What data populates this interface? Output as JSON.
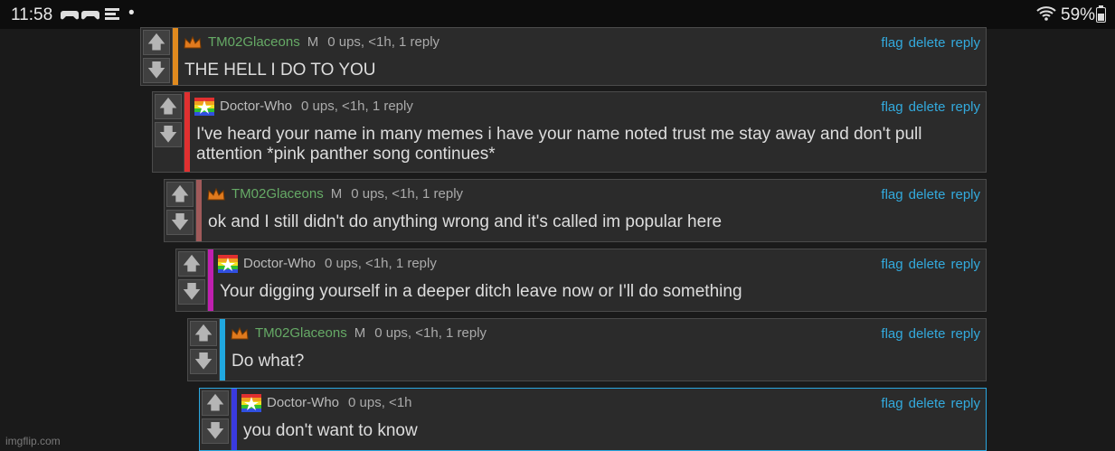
{
  "status_bar": {
    "time": "11:58",
    "battery": "59%"
  },
  "actions": {
    "flag": "flag",
    "delete": "delete",
    "reply": "reply"
  },
  "comments": [
    {
      "user": "TM02Glaceons",
      "badge": "M",
      "stats": "0 ups, <1h, 1 reply",
      "text": "THE HELL I DO TO YOU",
      "bar_color": "#e08a1e"
    },
    {
      "user": "Doctor-Who",
      "badge": "",
      "stats": "0 ups, <1h, 1 reply",
      "text": "I've heard your name in many memes i have your name noted trust me stay away and don't pull attention *pink panther song continues*",
      "bar_color": "#e03030"
    },
    {
      "user": "TM02Glaceons",
      "badge": "M",
      "stats": "0 ups, <1h, 1 reply",
      "text": "ok and I still didn't do anything wrong and it's called im popular here",
      "bar_color": "#a05a5a"
    },
    {
      "user": "Doctor-Who",
      "badge": "",
      "stats": "0 ups, <1h, 1 reply",
      "text": "Your digging yourself in a deeper ditch leave now or I'll do something",
      "bar_color": "#c020b0"
    },
    {
      "user": "TM02Glaceons",
      "badge": "M",
      "stats": "0 ups, <1h, 1 reply",
      "text": "Do what?",
      "bar_color": "#20a8e0"
    },
    {
      "user": "Doctor-Who",
      "badge": "",
      "stats": "0 ups, <1h",
      "text": "you don't want to know",
      "bar_color": "#3a3ae0"
    }
  ],
  "watermark": "imgflip.com"
}
